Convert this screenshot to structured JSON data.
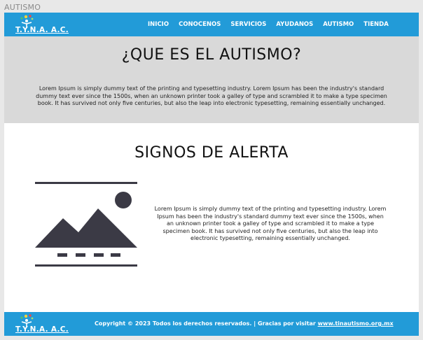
{
  "window": {
    "title": "AUTISMO"
  },
  "brand": {
    "logo_text": "T.Y.N.A. A.C."
  },
  "nav": {
    "items": [
      {
        "label": "INICIO"
      },
      {
        "label": "CONOCENOS"
      },
      {
        "label": "SERVICIOS"
      },
      {
        "label": "AYUDANOS"
      },
      {
        "label": "AUTISMO"
      },
      {
        "label": "TIENDA"
      }
    ]
  },
  "hero": {
    "title": "¿QUE ES EL AUTISMO?",
    "body": "Lorem Ipsum is simply dummy text of the printing and typesetting industry. Lorem Ipsum has been the industry's standard dummy text ever since the 1500s, when an unknown printer took a galley of type and scrambled it to make a type specimen book. It has survived not only five centuries, but also the leap into electronic typesetting, remaining essentially unchanged."
  },
  "signs": {
    "title": "SIGNOS DE ALERTA",
    "image_icon": "image-placeholder-icon",
    "body": "Lorem Ipsum is simply dummy text of the printing and typesetting industry. Lorem Ipsum has been the industry's standard dummy text ever since the 1500s, when an unknown printer took a galley of type and scrambled it to make a type specimen book. It has survived not only five centuries, but also the leap into electronic typesetting, remaining essentially unchanged."
  },
  "footer": {
    "copyright": "Copyright © 2023 Todos los derechos reservados. | Gracias por visitar ",
    "link_text": "www.tinautismo.org.mx"
  },
  "colors": {
    "header_bg": "#229bd8",
    "hero_bg": "#d9d9d9",
    "placeholder_dark": "#3b3a45"
  }
}
